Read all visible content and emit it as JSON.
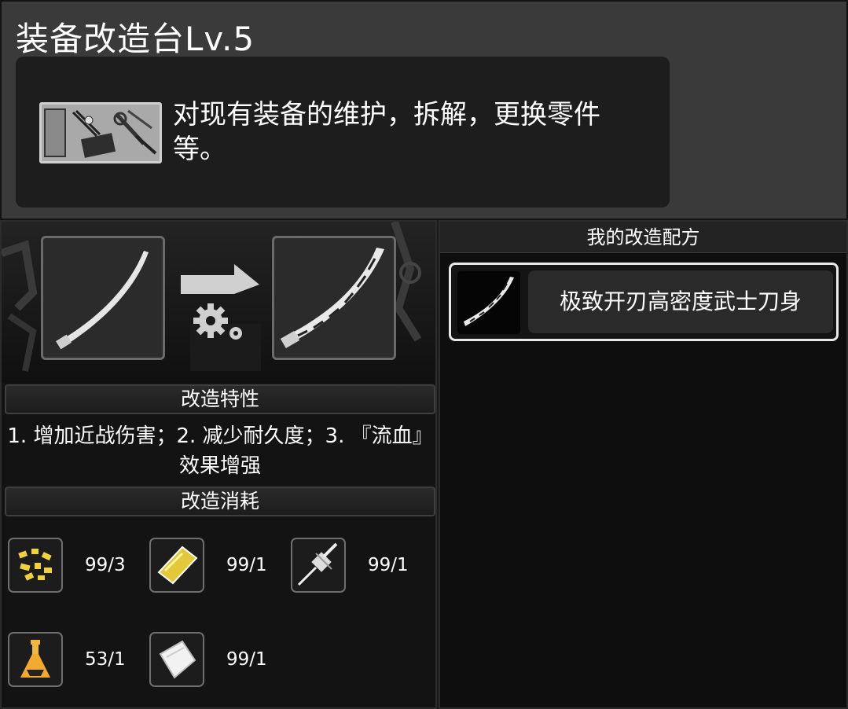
{
  "header": {
    "title": "装备改造台Lv.5",
    "description": "对现有装备的维护，拆解，更换零件等。",
    "thumb_icon": "tools-workbench-icon"
  },
  "left": {
    "from_item_icon": "katana-blade-icon",
    "to_item_icon": "serrated-katana-blade-icon",
    "arrow_icon": "arrow-gear-icon",
    "traits_header": "改造特性",
    "traits_text": "1. 增加近战伤害；2. 减少耐久度；3. 『流血』效果增强",
    "cost_header": "改造消耗",
    "materials": [
      {
        "icon": "gold-scraps-icon",
        "count": "99/3"
      },
      {
        "icon": "yellow-plate-icon",
        "count": "99/1"
      },
      {
        "icon": "drill-tool-icon",
        "count": "99/1"
      },
      {
        "icon": "flask-potion-icon",
        "count": "53/1"
      },
      {
        "icon": "white-cloth-icon",
        "count": "99/1"
      }
    ]
  },
  "right": {
    "header": "我的改造配方",
    "recipes": [
      {
        "label": "极致开刃高密度武士刀身",
        "icon": "serrated-katana-blade-icon"
      }
    ]
  }
}
